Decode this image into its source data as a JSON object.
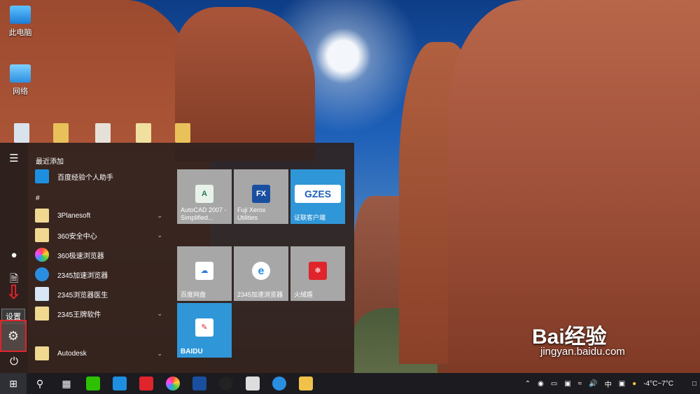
{
  "desktop": {
    "icons": [
      {
        "label": "此电脑"
      },
      {
        "label": "网络"
      }
    ]
  },
  "start_menu": {
    "recent_header": "最近添加",
    "recent_app": "百度经验个人助手",
    "hash_header": "#",
    "apps": [
      {
        "label": "3Planesoft",
        "expandable": true
      },
      {
        "label": "360安全中心",
        "expandable": true
      },
      {
        "label": "360极速浏览器",
        "expandable": false
      },
      {
        "label": "2345加速浏览器",
        "expandable": false
      },
      {
        "label": "2345浏览器医生",
        "expandable": false
      },
      {
        "label": "2345王牌软件",
        "expandable": true
      },
      {
        "label": "Autodesk",
        "expandable": true
      }
    ],
    "rail": {
      "settings_tooltip": "设置"
    },
    "tiles": [
      {
        "label": "AutoCAD 2007 - Simplified...",
        "icon": "A"
      },
      {
        "label": "Fuji Xerox Utilities",
        "icon": "FX"
      },
      {
        "label": "证联客户端",
        "icon": "GZES"
      },
      {
        "label": "百度网盘",
        "icon": "cloud"
      },
      {
        "label": "2345加速浏览器",
        "icon": "e"
      },
      {
        "label": "火绒盾",
        "icon": "shield"
      },
      {
        "label": "BAIDU",
        "icon": "pen"
      }
    ]
  },
  "taskbar": {
    "tray": {
      "ime": "中",
      "weather": "-4°C~7°C"
    }
  },
  "watermark": {
    "brand": "Bai经验",
    "url": "jingyan.baidu.com"
  }
}
